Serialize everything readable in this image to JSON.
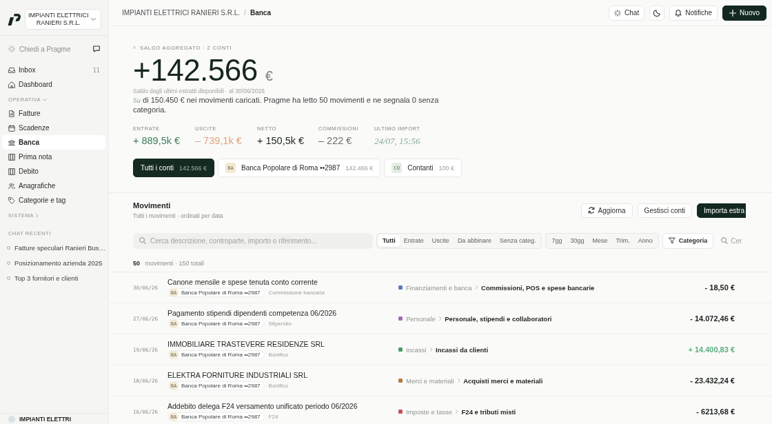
{
  "sidebar": {
    "org_switcher": "IMPIANTI ELETTRICI RANIERI S.R.L.",
    "ask": "Chiedi a Pragme",
    "items": [
      {
        "label": "Inbox",
        "count": "11",
        "selected": false
      },
      {
        "label": "Dashboard",
        "selected": false
      }
    ],
    "sections": [
      {
        "title": "OPERATIVA",
        "expanded": true,
        "items": [
          {
            "label": "Fatture",
            "selected": false
          },
          {
            "label": "Scadenze",
            "selected": false
          },
          {
            "label": "Banca",
            "selected": true
          },
          {
            "label": "Prima nota",
            "selected": false
          },
          {
            "label": "Debito",
            "selected": false
          },
          {
            "label": "Anagrafiche",
            "selected": false
          },
          {
            "label": "Categorie e tag",
            "selected": false
          }
        ]
      },
      {
        "title": "SISTEMA",
        "expanded": false
      }
    ],
    "recent_chats": {
      "title": "CHAT RECENTI",
      "items": [
        "Fatture speculari Ranieri Bus…",
        "Posizionamento azienda 2025",
        "Top 3 fornitori e clienti"
      ]
    },
    "account": "IMPIANTI ELETTRI"
  },
  "header": {
    "breadcrumb": {
      "parent": "IMPIANTI ELETTRICI RANIERI S.R.L.",
      "separator": "/",
      "current": "Banca"
    },
    "buttons": [
      {
        "kind": "chat",
        "label": "Chat"
      },
      {
        "kind": "theme"
      },
      {
        "kind": "bell",
        "label": "Notifiche"
      },
      {
        "kind": "primary",
        "label": "Nuovo"
      }
    ]
  },
  "balance": {
    "eyebrow": "SALDO AGGREGATO · 2 CONTI",
    "amount": "+142.566",
    "currency": "€",
    "as_of": "Saldo dagli ultimi estratti disponibili · al 30/06/2026",
    "summary": {
      "faded": "Su",
      "text": "di 150.450 € nei movimenti caricati. Pragme ha letto 50 movimenti e ne segnala 0 senza categoria."
    }
  },
  "stats": [
    {
      "label": "ENTRATE",
      "value": "+ 889,5k €",
      "kind": "positive"
    },
    {
      "label": "USCITE",
      "value": "– 739,1k €",
      "kind": "negative"
    },
    {
      "label": "NETTO",
      "value": "+ 150,5k €",
      "kind": "neutral"
    },
    {
      "label": "COMMISSIONI",
      "value": "– 222 €",
      "kind": "muted"
    },
    {
      "label": "ULTIMO IMPORT",
      "value": "24/07, 15:56",
      "kind": "faded"
    }
  ],
  "accounts": [
    {
      "label": "Tutti i conti",
      "balance": "142.566 €",
      "selected": true
    },
    {
      "badge": "BA",
      "label": "Banca Popolare di Roma ••2987",
      "balance": "142.466 €",
      "selected": false,
      "color": "#f3e9d2"
    },
    {
      "badge": "CO",
      "label": "Contanti",
      "balance": "100 €",
      "selected": false,
      "color": "#e2eee5"
    }
  ],
  "movements": {
    "title": "Movimenti",
    "subtitle": "Tutti i movimenti · ordinati per data",
    "actions": [
      {
        "kind": "refresh",
        "label": "Aggiorna"
      },
      {
        "kind": "plain",
        "label": "Gestisci conti"
      },
      {
        "kind": "primary",
        "label": "Importa estra"
      }
    ],
    "search": {
      "placeholder": "Cerca descrizione, controparte, importo o riferimento..."
    },
    "type_filters": [
      {
        "label": "Tutti",
        "selected": true
      },
      {
        "label": "Entrate",
        "selected": false
      },
      {
        "label": "Uscite",
        "selected": false
      },
      {
        "label": "Da abbinare",
        "selected": false
      },
      {
        "label": "Senza categ.",
        "selected": false
      }
    ],
    "period_filters": [
      {
        "label": "7gg",
        "selected": false
      },
      {
        "label": "30gg",
        "selected": false
      },
      {
        "label": "Mese",
        "selected": false
      },
      {
        "label": "Trim.",
        "selected": false
      },
      {
        "label": "Anno",
        "selected": false
      }
    ],
    "category_button": "Categoria",
    "quick_search": {
      "placeholder": "Cer"
    },
    "count": "**50** movimenti · 150 totali",
    "rows": [
      {
        "date": "30/06/26",
        "description": "Canone mensile e spese tenuta conto corrente",
        "account_badge": "BA",
        "account": "Banca Popolare di Roma ••2987",
        "type": "Commissione bancaria",
        "category_group": "Finanziamenti e banca",
        "category": "Commissioni, POS e spese bancarie",
        "color": "#5b78c4",
        "amount": "- 18,50 €",
        "kind": "out"
      },
      {
        "date": "27/06/26",
        "description": "Pagamento stipendi dipendenti competenza 06/2026",
        "account_badge": "BA",
        "account": "Banca Popolare di Roma ••2987",
        "type": "Stipendio",
        "category_group": "Personale",
        "category": "Personale, stipendi e collaboratori",
        "color": "#a46cb0",
        "amount": "- 14.072,46 €",
        "kind": "out"
      },
      {
        "date": "19/06/26",
        "description": "IMMOBILIARE TRASTEVERE RESIDENZE SRL",
        "account_badge": "BA",
        "account": "Banca Popolare di Roma ••2987",
        "type": "Bonifico",
        "category_group": "Incassi",
        "category": "Incassi da clienti",
        "color": "#4b9a67",
        "amount": "+ 14.400,83 €",
        "kind": "in"
      },
      {
        "date": "18/06/26",
        "description": "ELEKTRA FORNITURE INDUSTRIALI SRL",
        "account_badge": "BA",
        "account": "Banca Popolare di Roma ••2987",
        "type": "Bonifico",
        "category_group": "Merci e materiali",
        "category": "Acquisti merci e materiali",
        "color": "#b07c3d",
        "amount": "- 23.432,24 €",
        "kind": "out"
      },
      {
        "date": "16/06/26",
        "description": "Addebito delega F24 versamento unificato periodo 06/2026",
        "account_badge": "BA",
        "account": "Banca Popolare di Roma ••2987",
        "type": "F24",
        "category_group": "Imposte e tasse",
        "category": "F24 e tributi misti",
        "color": "#c2505c",
        "amount": "- 6213,68 €",
        "kind": "out"
      }
    ]
  }
}
